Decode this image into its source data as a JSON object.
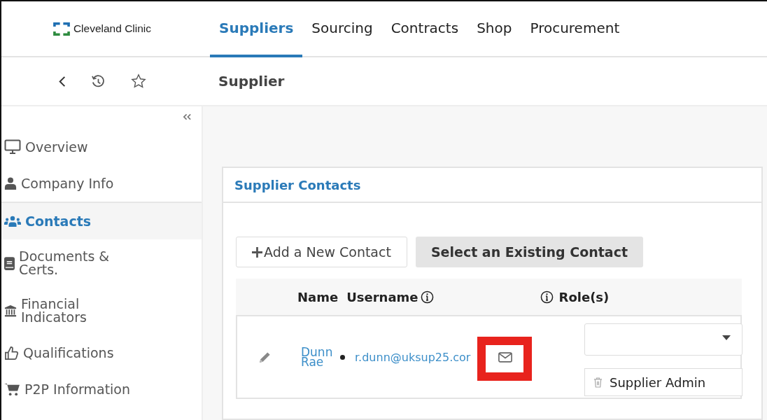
{
  "brand": {
    "name": "Cleveland Clinic"
  },
  "nav_tabs": [
    {
      "label": "Suppliers",
      "selected": true
    },
    {
      "label": "Sourcing",
      "selected": false
    },
    {
      "label": "Contracts",
      "selected": false
    },
    {
      "label": "Shop",
      "selected": false
    },
    {
      "label": "Procurement",
      "selected": false
    }
  ],
  "page_title": "Supplier",
  "sidebar": {
    "items": [
      {
        "label": "Overview",
        "selected": false
      },
      {
        "label": "Company Info",
        "selected": false
      },
      {
        "label": "Contacts",
        "selected": true
      },
      {
        "label": "Documents & Certs.",
        "selected": false
      },
      {
        "label": "Financial Indicators",
        "selected": false
      },
      {
        "label": "Qualifications",
        "selected": false
      },
      {
        "label": "P2P Information",
        "selected": false
      }
    ]
  },
  "panel": {
    "title": "Supplier Contacts",
    "buttons": [
      {
        "label": "Add a New Contact",
        "kind": "add"
      },
      {
        "label": "Select an Existing Contact",
        "kind": "select"
      }
    ],
    "table": {
      "columns": [
        "Name",
        "Username",
        "Role(s)"
      ],
      "rows": [
        {
          "name": "Dunn Rae",
          "username": "r.dunn@uksup25.cor",
          "roles": [
            "Supplier Admin"
          ]
        }
      ]
    }
  },
  "highlight": true
}
